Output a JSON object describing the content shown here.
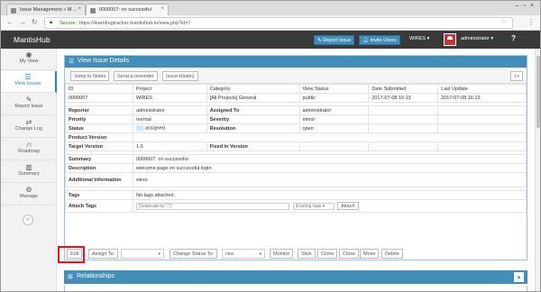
{
  "browser": {
    "tabs": [
      {
        "label": "Issue Management » M…",
        "active": false
      },
      {
        "label": "0000007: on successful",
        "active": true
      }
    ],
    "secure_label": "Secure",
    "url": "https://learnbugtracker.mantishub.io/view.php?id=7"
  },
  "navbar": {
    "brand": "MantisHub",
    "report_issue": "Report Issue",
    "invite_users": "Invite Users",
    "project": "WIRES",
    "user": "administrator",
    "help": "?"
  },
  "sidebar": {
    "items": [
      {
        "label": "My View",
        "icon": "dashboard-icon",
        "active": false
      },
      {
        "label": "View Issues",
        "icon": "list-icon",
        "active": true
      },
      {
        "label": "Report Issue",
        "icon": "edit-icon",
        "active": false
      },
      {
        "label": "Change Log",
        "icon": "retweet-icon",
        "active": false
      },
      {
        "label": "Roadmap",
        "icon": "road-icon",
        "active": false
      },
      {
        "label": "Summary",
        "icon": "bar-chart-icon",
        "active": false
      },
      {
        "label": "Manage",
        "icon": "gears-icon",
        "active": false
      }
    ]
  },
  "panel": {
    "title": "View Issue Details",
    "buttons": {
      "jump": "Jump to Notes",
      "reminder": "Send a reminder",
      "history": "Issue History",
      "prev": "<<"
    },
    "headers": [
      "ID",
      "Project",
      "Category",
      "View Status",
      "Date Submitted",
      "Last Update"
    ],
    "row": [
      "0000007",
      "WIRES",
      "[All Projects] General",
      "public",
      "2017-07-08 16:13",
      "2017-07-08 16:13"
    ],
    "fields": {
      "reporter_label": "Reporter",
      "reporter": "administrator",
      "assigned_label": "Assigned To",
      "assigned": "administrator",
      "priority_label": "Priority",
      "priority": "normal",
      "severity_label": "Severity",
      "severity": "minor",
      "status_label": "Status",
      "status": "assigned",
      "resolution_label": "Resolution",
      "resolution": "open",
      "product_version_label": "Product Version",
      "product_version": "",
      "target_version_label": "Target Version",
      "target_version": "1.0",
      "fixed_version_label": "Fixed in Version",
      "fixed_version": "",
      "summary_label": "Summary",
      "summary": "0000007: on successful",
      "description_label": "Description",
      "description": "welcome page on successful login",
      "additional_label": "Additional Information",
      "additional": "wires",
      "tags_label": "Tags",
      "tags": "No tags attached.",
      "attach_tags_label": "Attach Tags",
      "tag_placeholder": "(Seperate by \",\")",
      "existing_tags": "Existing tags",
      "attach_button": "Attach"
    },
    "actions": {
      "edit": "Edit",
      "assign_to": "Assign To:",
      "change_status": "Change Status To:",
      "status_select": "new",
      "monitor": "Monitor",
      "stick": "Stick",
      "clone": "Clone",
      "close": "Close",
      "move": "Move",
      "delete": "Delete"
    }
  },
  "relationships": {
    "title": "Relationships"
  }
}
